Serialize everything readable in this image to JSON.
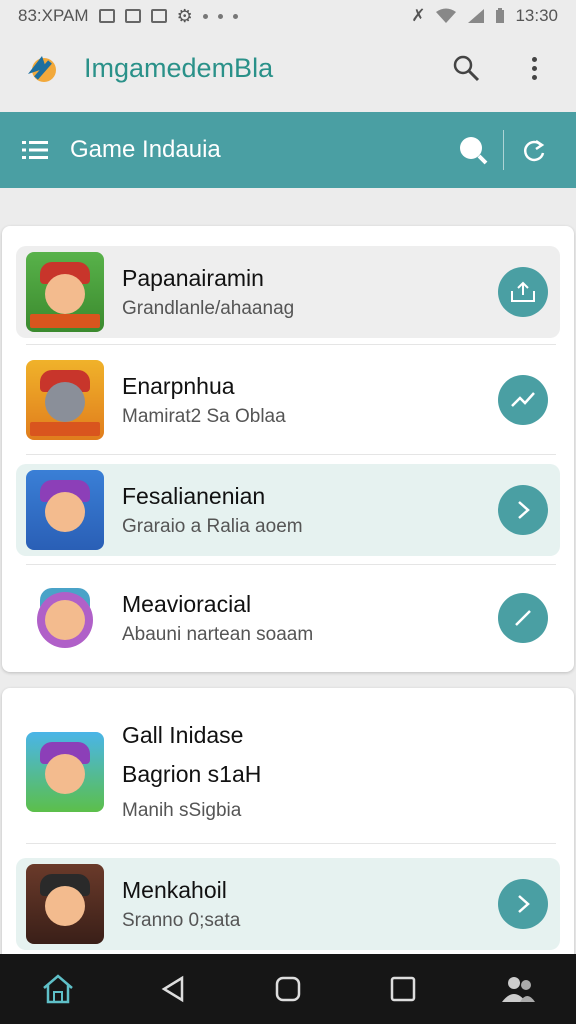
{
  "status_bar": {
    "left_text": "83:XPAM",
    "time": "13:30"
  },
  "app_bar": {
    "title": "ImgamedemBla",
    "search_icon": "search-icon",
    "menu_icon": "more-vert-icon"
  },
  "toolbar": {
    "title": "Game Indauia"
  },
  "list1": [
    {
      "title": "Papanairamin",
      "subtitle": "Grandlanle/ahaanag",
      "action_icon": "share-icon"
    },
    {
      "title": "Enarpnhua",
      "subtitle": "Mamirat2 Sa Oblaa",
      "action_icon": "trend-icon"
    },
    {
      "title": "Fesalianenian",
      "subtitle": "Graraio a Ralia aoem",
      "action_icon": "chevron-right-icon"
    },
    {
      "title": "Meavioracial",
      "subtitle": "Abauni nartean soaam",
      "action_icon": "edit-icon"
    }
  ],
  "list2": [
    {
      "title": "Gall Inidase",
      "line2": "Bagrion s1aH",
      "subtitle": "Manih sSigbia"
    },
    {
      "title": "Menkahoil",
      "subtitle": "Sranno 0;sata",
      "action_icon": "chevron-right-icon"
    }
  ],
  "colors": {
    "accent": "#4a9fa3",
    "title_teal": "#2a9189"
  }
}
